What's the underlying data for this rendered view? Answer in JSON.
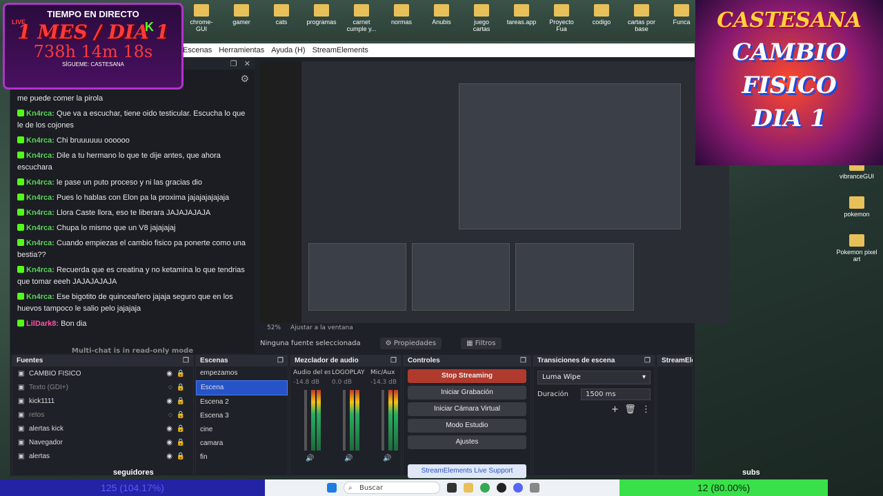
{
  "desktop": {
    "top_icons": [
      "chrome-GUI",
      "gamer",
      "cats",
      "programas",
      "carnet cumple y...",
      "normas",
      "Anubis",
      "juego cartas",
      "tareas.app",
      "Proyecto Fua",
      "codigo",
      "cartas por base",
      "Funca"
    ],
    "right_icons": [
      "vibranceGUI",
      "pokemon",
      "Pokemon pixel art"
    ]
  },
  "obs": {
    "menu": [
      "Escenas",
      "Herramientas",
      "Ayuda (H)",
      "StreamElements"
    ],
    "chat": {
      "messages": [
        {
          "user": "",
          "text": "me puede comer la pirola"
        },
        {
          "user": "Kn4rca:",
          "text": "Que va a escuchar, tiene oido testicular. Escucha lo que le de los cojones"
        },
        {
          "user": "Kn4rca:",
          "text": "Chi bruuuuuu oooooo"
        },
        {
          "user": "Kn4rca:",
          "text": "Dile a tu hermano lo que te dije antes, que ahora escuchara"
        },
        {
          "user": "Kn4rca:",
          "text": "le pase un puto proceso y ni las gracias dio"
        },
        {
          "user": "Kn4rca:",
          "text": "Pues lo hablas con Elon pa la proxima jajajajajajaja"
        },
        {
          "user": "Kn4rca:",
          "text": "Llora Caste llora, eso te liberara JAJAJAJAJA"
        },
        {
          "user": "Kn4rca:",
          "text": "Chupa lo mismo que un V8 jajajajaj"
        },
        {
          "user": "Kn4rca:",
          "text": "Cuando empiezas el cambio fisico pa ponerte como una bestia??"
        },
        {
          "user": "Kn4rca:",
          "text": "Recuerda que es creatina y no ketamina lo que tendrias que tomar eeeh JAJAJAJAJA"
        },
        {
          "user": "Kn4rca:",
          "text": "Ese bigotito de quinceañero jajaja seguro que en los huevos tampoco le salio pelo jajajaja"
        },
        {
          "user": "LilDark8:",
          "text": "Bon dia"
        }
      ],
      "footer": "Multi-chat is in read-only mode"
    },
    "zoom": "52%",
    "fit": "Ajustar a la ventana",
    "no_source": "Ninguna fuente seleccionada",
    "properties_btn": "Propiedades",
    "filters_btn": "Filtros",
    "docks": {
      "sources": {
        "title": "Fuentes",
        "items": [
          {
            "name": "CAMBIO FISICO",
            "dim": false
          },
          {
            "name": "Texto (GDI+)",
            "dim": true
          },
          {
            "name": "kick1111",
            "dim": false
          },
          {
            "name": "retos",
            "dim": true
          },
          {
            "name": "alertas kick",
            "dim": false
          },
          {
            "name": "Navegador",
            "dim": false
          },
          {
            "name": "alertas",
            "dim": false
          }
        ]
      },
      "scenes": {
        "title": "Escenas",
        "items": [
          "empezamos",
          "Escena",
          "Escena 2",
          "Escena 3",
          "cine",
          "camara",
          "fin"
        ],
        "selected": 1
      },
      "mixer": {
        "title": "Mezclador de audio",
        "channels": [
          {
            "name": "Audio del escritorio",
            "db": "-14.8 dB"
          },
          {
            "name": "LOGOPLAY",
            "db": "0.0 dB"
          },
          {
            "name": "Mic/Aux",
            "db": "-14.3 dB"
          }
        ]
      },
      "controls": {
        "title": "Controles",
        "buttons": [
          "Stop Streaming",
          "Iniciar Grabación",
          "Iniciar Cámara Virtual",
          "Modo Estudio",
          "Ajustes"
        ],
        "support": "StreamElements Live Support"
      },
      "transitions": {
        "title": "Transiciones de escena",
        "selected": "Luma Wipe",
        "duration_label": "Duración",
        "duration_value": "1500 ms"
      },
      "multistream": {
        "title": "StreamElements Multi-Streaming"
      }
    }
  },
  "overlay": {
    "timer": {
      "title": "TIEMPO EN DIRECTO",
      "live": "LIVE",
      "headline": "1 MES / DIA 1",
      "time": "738h 14m 18s",
      "follow": "SÍGUEME: CASTESANA"
    },
    "banner": {
      "brand": "CASTESANA",
      "line1": "CAMBIO",
      "line2": "FISICO",
      "line3": "DIA 1"
    },
    "followers": {
      "label": "seguidores",
      "value": "125 (104.17%)",
      "fill": 1.0
    },
    "subs": {
      "label": "subs",
      "value": "12 (80.00%)",
      "fill": 0.8
    }
  },
  "taskbar": {
    "search_placeholder": "Buscar"
  }
}
